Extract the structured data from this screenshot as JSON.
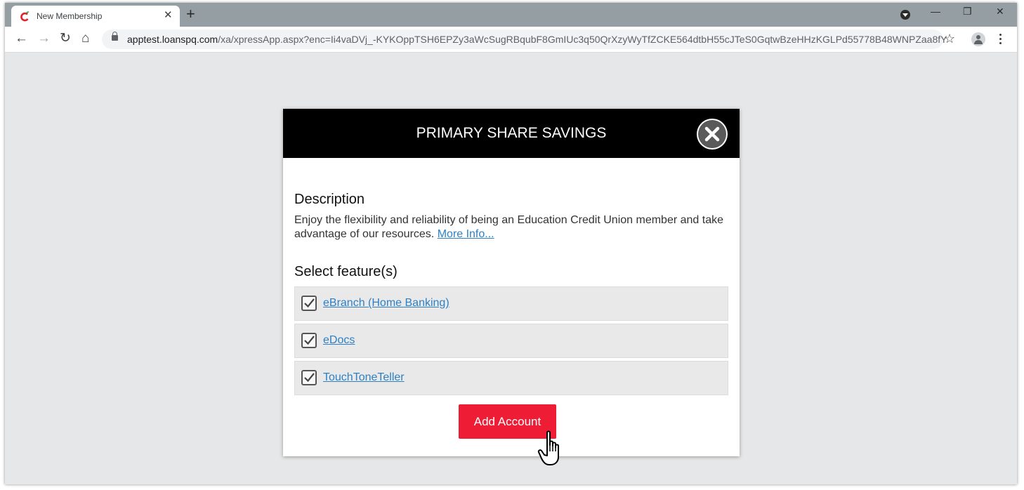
{
  "browser": {
    "tab": {
      "title": "New Membership",
      "close": "✕"
    },
    "new_tab": "+",
    "window_controls": {
      "minimize": "—",
      "restore": "❐",
      "close": "✕"
    },
    "nav": {
      "back": "←",
      "forward": "→",
      "reload": "↻",
      "home": "⌂"
    },
    "url": {
      "host": "apptest.loanspq.com",
      "path": "/xa/xpressApp.aspx?enc=Ii4vaDVj_-KYKOppTSH6EPZy3aWcSugRBqubF8GmIUc3q50QrXzyWyTfZCKE564dtbH55cJTeS0GqtwBzeHHzKGLPd55778B48WNPZaa8fY"
    },
    "bookmark": "☆"
  },
  "modal": {
    "title": "PRIMARY SHARE SAVINGS",
    "description_heading": "Description",
    "description_text": "Enjoy the flexibility and reliability of being an Education Credit Union member and take advantage of our resources.",
    "more_info": "More Info...",
    "features_heading": "Select feature(s)",
    "features": [
      {
        "label": "eBranch (Home Banking)",
        "checked": true
      },
      {
        "label": "eDocs",
        "checked": true
      },
      {
        "label": "TouchToneTeller",
        "checked": true
      }
    ],
    "add_button": "Add Account"
  },
  "colors": {
    "accent": "#ee1c35",
    "link": "#2f80c4",
    "header": "#000000"
  }
}
